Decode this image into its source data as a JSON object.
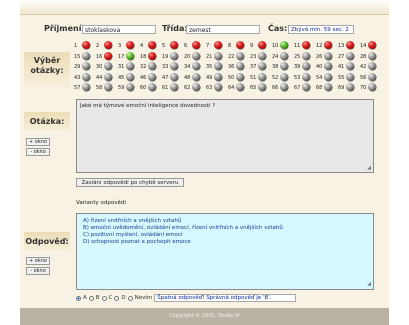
{
  "header": {
    "surname_label": "Příjmení:",
    "surname_value": "stoklaskova",
    "class_label": "Třída:",
    "class_value": "zemest",
    "time_label": "Čas:",
    "time_value": "Zbývá min. 59 sec. 2"
  },
  "sidebar": {
    "select_label": "Výběr otázky:",
    "question_label": "Otázka:",
    "answer_label": "Odpověď:",
    "plus_window": "+ okno",
    "minus_window": "- okno"
  },
  "questions": [
    {
      "n": "1",
      "s": "red"
    },
    {
      "n": "2",
      "s": "red"
    },
    {
      "n": "3",
      "s": "red"
    },
    {
      "n": "4",
      "s": "red"
    },
    {
      "n": "5",
      "s": "red"
    },
    {
      "n": "6",
      "s": "red"
    },
    {
      "n": "7",
      "s": "red"
    },
    {
      "n": "8",
      "s": "red"
    },
    {
      "n": "9",
      "s": "red"
    },
    {
      "n": "10",
      "s": "green"
    },
    {
      "n": "11",
      "s": "red"
    },
    {
      "n": "12",
      "s": "red"
    },
    {
      "n": "13",
      "s": "red"
    },
    {
      "n": "14",
      "s": "red"
    },
    {
      "n": "15",
      "s": "blank"
    },
    {
      "n": "16",
      "s": "red"
    },
    {
      "n": "17",
      "s": "green"
    },
    {
      "n": "18",
      "s": "red"
    },
    {
      "n": "19",
      "s": "blank"
    },
    {
      "n": "20",
      "s": "blank"
    },
    {
      "n": "21",
      "s": "blank"
    },
    {
      "n": "22",
      "s": "blank"
    },
    {
      "n": "23",
      "s": "blank"
    },
    {
      "n": "24",
      "s": "blank"
    },
    {
      "n": "25",
      "s": "blank"
    },
    {
      "n": "26",
      "s": "blank"
    },
    {
      "n": "27",
      "s": "blank"
    },
    {
      "n": "28",
      "s": "blank"
    },
    {
      "n": "29",
      "s": "blank"
    },
    {
      "n": "30",
      "s": "blank"
    },
    {
      "n": "31",
      "s": "blank"
    },
    {
      "n": "32",
      "s": "blank"
    },
    {
      "n": "33",
      "s": "blank"
    },
    {
      "n": "34",
      "s": "blank"
    },
    {
      "n": "35",
      "s": "blank"
    },
    {
      "n": "36",
      "s": "blank"
    },
    {
      "n": "37",
      "s": "blank"
    },
    {
      "n": "38",
      "s": "blank"
    },
    {
      "n": "39",
      "s": "blank"
    },
    {
      "n": "40",
      "s": "blank"
    },
    {
      "n": "41",
      "s": "blank"
    },
    {
      "n": "42",
      "s": "blank"
    },
    {
      "n": "43",
      "s": "blank"
    },
    {
      "n": "44",
      "s": "blank"
    },
    {
      "n": "45",
      "s": "blank"
    },
    {
      "n": "46",
      "s": "blank"
    },
    {
      "n": "47",
      "s": "blank"
    },
    {
      "n": "48",
      "s": "blank"
    },
    {
      "n": "49",
      "s": "blank"
    },
    {
      "n": "50",
      "s": "blank"
    },
    {
      "n": "51",
      "s": "blank"
    },
    {
      "n": "52",
      "s": "blank"
    },
    {
      "n": "53",
      "s": "blank"
    },
    {
      "n": "54",
      "s": "blank"
    },
    {
      "n": "55",
      "s": "blank"
    },
    {
      "n": "56",
      "s": "blank"
    },
    {
      "n": "57",
      "s": "blank"
    },
    {
      "n": "58",
      "s": "blank"
    },
    {
      "n": "59",
      "s": "blank"
    },
    {
      "n": "60",
      "s": "blank"
    },
    {
      "n": "61",
      "s": "blank"
    },
    {
      "n": "62",
      "s": "blank"
    },
    {
      "n": "63",
      "s": "blank"
    },
    {
      "n": "64",
      "s": "blank"
    },
    {
      "n": "65",
      "s": "blank"
    },
    {
      "n": "66",
      "s": "blank"
    },
    {
      "n": "67",
      "s": "blank"
    },
    {
      "n": "68",
      "s": "blank"
    },
    {
      "n": "69",
      "s": "blank"
    },
    {
      "n": "70",
      "s": "blank"
    }
  ],
  "question_text": "Jaké má týmové emoční inteligence dovednosti ?",
  "send_button": "Zaslání odpovědí po chybě serveru",
  "variants_label": "Varianty odpovědí",
  "answers": [
    "A)   řízení vnitřních a vnějších vztahů",
    "B)   emoční uvědomění, ovládání emocí, řízení vnitřních a vnějších vztahů",
    "C)   pozitivní myšlení, ovládání emocí",
    "D)   schopnost poznat a pochopit emoce"
  ],
  "answer_row": {
    "options": [
      "A",
      "B",
      "C",
      "D",
      "Nevím"
    ],
    "selected": "A",
    "result": "Špatná odpověď! Správná odpověď je 'B'."
  },
  "footer": "Copyright © 2005, Studio JP",
  "colors": {
    "answer_bg": "#d6f8ff",
    "frame_bg": "#f7f2e4",
    "footer_bg": "#b9b3a6"
  }
}
